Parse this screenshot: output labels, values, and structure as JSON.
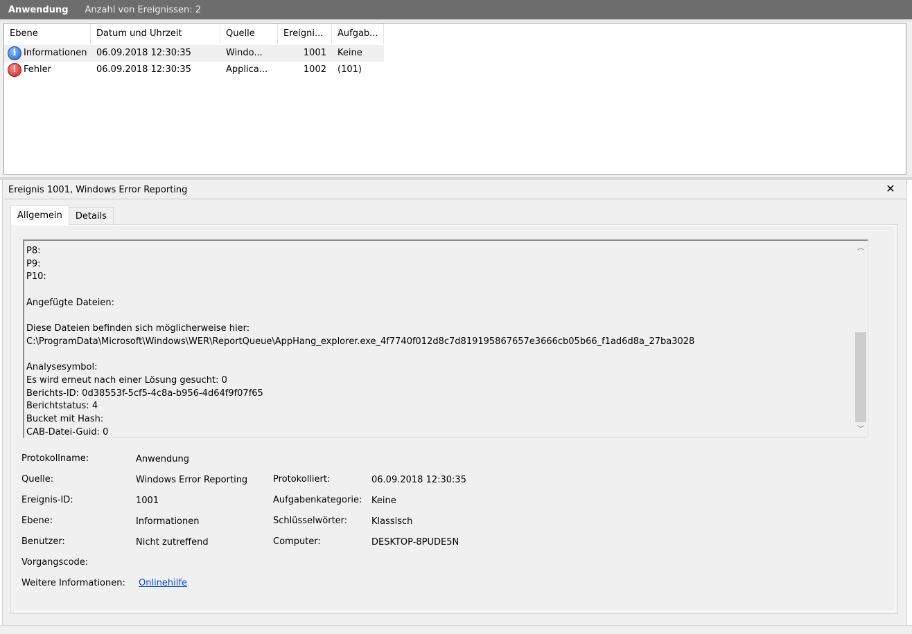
{
  "header": {
    "title": "Anwendung",
    "count_label": "Anzahl von Ereignissen: 2"
  },
  "columns": [
    "Ebene",
    "Datum und Uhrzeit",
    "Quelle",
    "Ereigni...",
    "Aufgab..."
  ],
  "rows": [
    {
      "level_icon": "info-icon",
      "level": "Informationen",
      "date": "06.09.2018 12:30:35",
      "source": "Windo...",
      "id": "1001",
      "task": "Keine"
    },
    {
      "level_icon": "error-icon",
      "level": "Fehler",
      "date": "06.09.2018 12:30:35",
      "source": "Applica...",
      "id": "1002",
      "task": "(101)"
    }
  ],
  "detail": {
    "title": "Ereignis 1001, Windows Error Reporting",
    "close_icon": "close-icon",
    "tabs": [
      "Allgemein",
      "Details"
    ],
    "text_lines": [
      "P8:",
      "P9:",
      "P10:",
      "",
      "Angefügte Dateien:",
      "",
      "Diese Dateien befinden sich möglicherweise hier:",
      "C:\\ProgramData\\Microsoft\\Windows\\WER\\ReportQueue\\AppHang_explorer.exe_4f7740f012d8c7d819195867657e3666cb05b66_f1ad6d8a_27ba3028",
      "",
      "Analysesymbol:",
      "Es wird erneut nach einer Lösung gesucht: 0",
      "Berichts-ID: 0d38553f-5cf5-4c8a-b956-4d64f9f07f65",
      "Berichtstatus: 4",
      "Bucket mit Hash:",
      "CAB-Datei-Guid: 0"
    ],
    "props": {
      "protokollname_label": "Protokollname:",
      "protokollname": "Anwendung",
      "quelle_label": "Quelle:",
      "quelle": "Windows Error Reporting",
      "protokolliert_label": "Protokolliert:",
      "protokolliert": "06.09.2018 12:30:35",
      "ereignis_label": "Ereignis-ID:",
      "ereignis": "1001",
      "aufgabe_label": "Aufgabenkategorie:",
      "aufgabe": "Keine",
      "ebene_label": "Ebene:",
      "ebene": "Informationen",
      "schluessel_label": "Schlüsselwörter:",
      "schluessel": "Klassisch",
      "benutzer_label": "Benutzer:",
      "benutzer": "Nicht zutreffend",
      "computer_label": "Computer:",
      "computer": "DESKTOP-8PUDE5N",
      "vorgang_label": "Vorgangscode:",
      "weitere_label": "Weitere Informationen:",
      "weitere_link": "Onlinehilfe"
    }
  }
}
